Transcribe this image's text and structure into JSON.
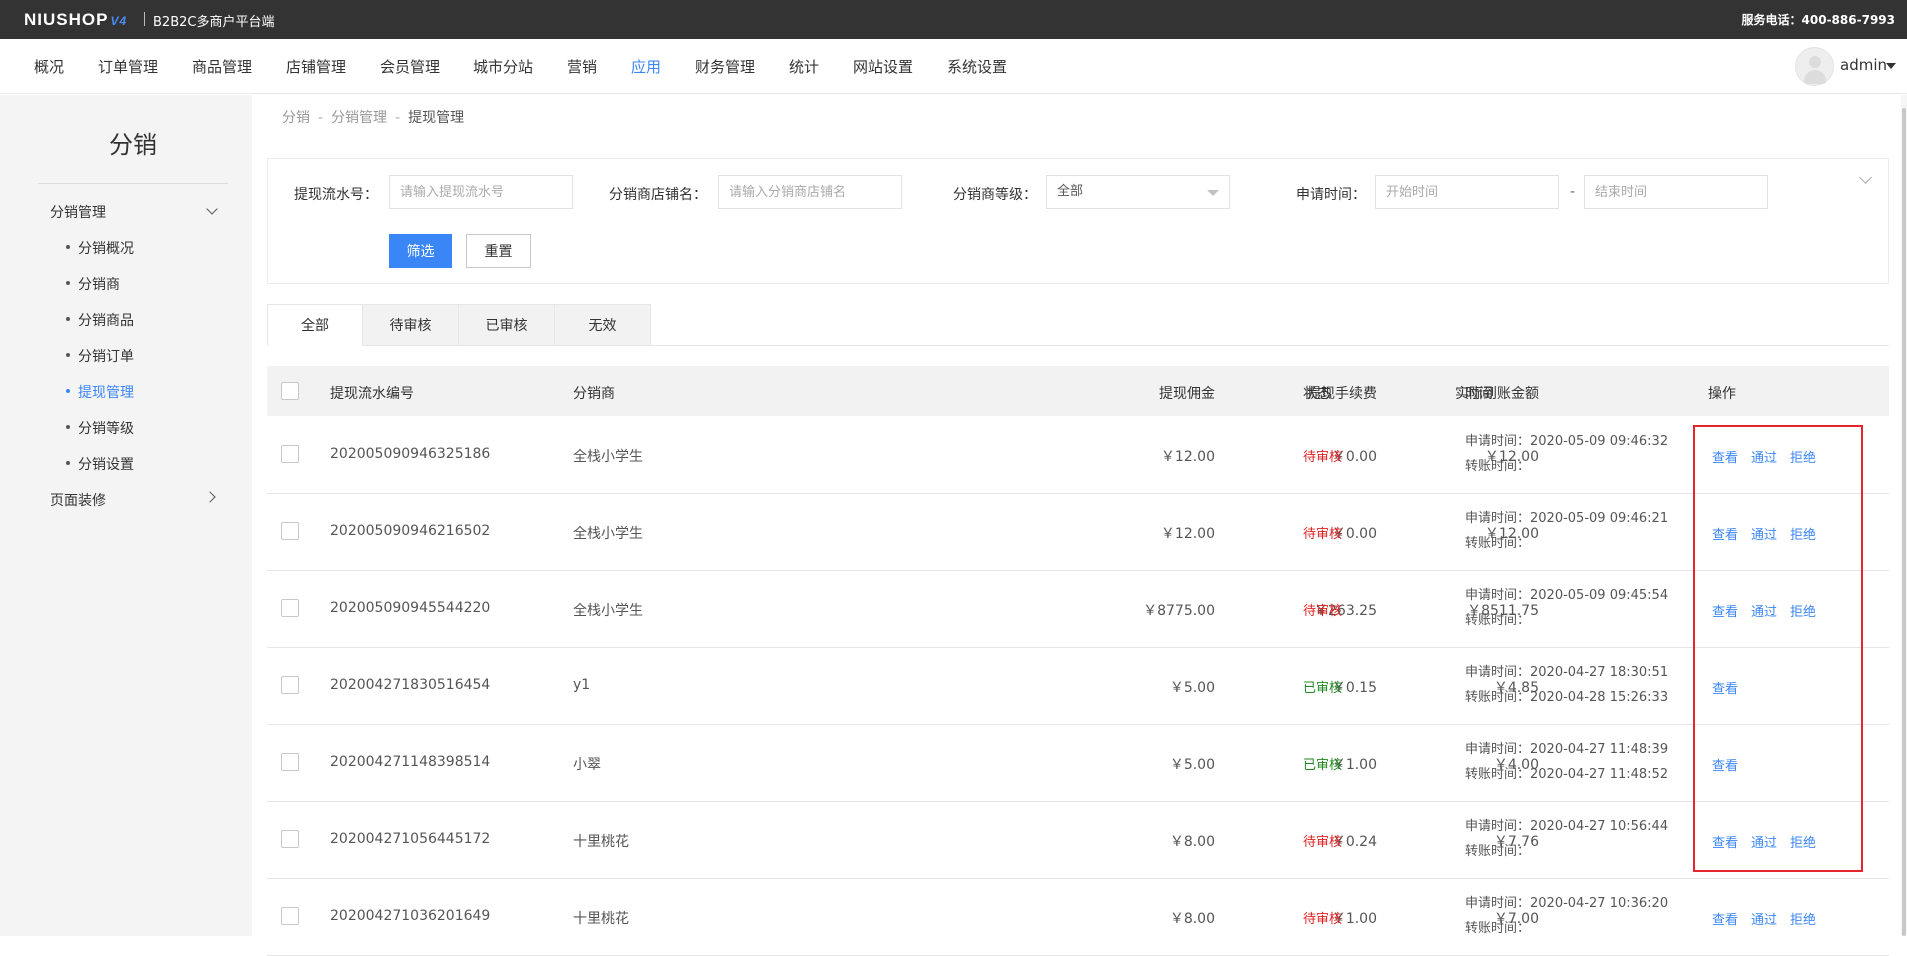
{
  "topbar": {
    "logo_text": "NIUSHOP",
    "logo_version": "V4",
    "platform": "B2B2C多商户平台端",
    "phone_label": "服务电话：400-886-7993"
  },
  "nav": {
    "items": [
      "概况",
      "订单管理",
      "商品管理",
      "店铺管理",
      "会员管理",
      "城市分站",
      "营销",
      "应用",
      "财务管理",
      "统计",
      "网站设置",
      "系统设置"
    ],
    "active": "应用",
    "user": "admin"
  },
  "sidebar": {
    "title": "分销",
    "group1": "分销管理",
    "items": [
      "分销概况",
      "分销商",
      "分销商品",
      "分销订单",
      "提现管理",
      "分销等级",
      "分销设置"
    ],
    "active": "提现管理",
    "group2": "页面装修"
  },
  "breadcrumb": {
    "items": [
      "分销",
      "分销管理",
      "提现管理"
    ],
    "sep": "-"
  },
  "filter": {
    "serial_label": "提现流水号：",
    "serial_placeholder": "请输入提现流水号",
    "shop_label": "分销商店铺名：",
    "shop_placeholder": "请输入分销商店铺名",
    "level_label": "分销商等级：",
    "level_value": "全部",
    "time_label": "申请时间：",
    "start_placeholder": "开始时间",
    "end_placeholder": "结束时间",
    "dash": "-",
    "filter_button": "筛选",
    "reset_button": "重置"
  },
  "tabs": [
    "全部",
    "待审核",
    "已审核",
    "无效"
  ],
  "active_tab": "全部",
  "table": {
    "headers": [
      "提现流水编号",
      "分销商",
      "提现佣金",
      "提现手续费",
      "实际到账金额",
      "状态",
      "时间",
      "操作"
    ],
    "apply_prefix": "申请时间：",
    "transfer_prefix": "转账时间：",
    "rows": [
      {
        "serial": "202005090946325186",
        "distributor": "全栈小学生",
        "commission": "￥12.00",
        "fee": "￥0.00",
        "actual": "￥12.00",
        "status": "待审核",
        "status_type": "pending",
        "apply_time": "2020-05-09 09:46:32",
        "transfer_time": "",
        "actions": [
          "查看",
          "通过",
          "拒绝"
        ]
      },
      {
        "serial": "202005090946216502",
        "distributor": "全栈小学生",
        "commission": "￥12.00",
        "fee": "￥0.00",
        "actual": "￥12.00",
        "status": "待审核",
        "status_type": "pending",
        "apply_time": "2020-05-09 09:46:21",
        "transfer_time": "",
        "actions": [
          "查看",
          "通过",
          "拒绝"
        ]
      },
      {
        "serial": "202005090945544220",
        "distributor": "全栈小学生",
        "commission": "￥8775.00",
        "fee": "￥263.25",
        "actual": "￥8511.75",
        "status": "待审核",
        "status_type": "pending",
        "apply_time": "2020-05-09 09:45:54",
        "transfer_time": "",
        "actions": [
          "查看",
          "通过",
          "拒绝"
        ]
      },
      {
        "serial": "202004271830516454",
        "distributor": "y1",
        "commission": "￥5.00",
        "fee": "￥0.15",
        "actual": "￥4.85",
        "status": "已审核",
        "status_type": "approved",
        "apply_time": "2020-04-27 18:30:51",
        "transfer_time": "2020-04-28 15:26:33",
        "actions": [
          "查看"
        ]
      },
      {
        "serial": "202004271148398514",
        "distributor": "小翠",
        "commission": "￥5.00",
        "fee": "￥1.00",
        "actual": "￥4.00",
        "status": "已审核",
        "status_type": "approved",
        "apply_time": "2020-04-27 11:48:39",
        "transfer_time": "2020-04-27 11:48:52",
        "actions": [
          "查看"
        ]
      },
      {
        "serial": "202004271056445172",
        "distributor": "十里桃花",
        "commission": "￥8.00",
        "fee": "￥0.24",
        "actual": "￥7.76",
        "status": "待审核",
        "status_type": "pending",
        "apply_time": "2020-04-27 10:56:44",
        "transfer_time": "",
        "actions": [
          "查看",
          "通过",
          "拒绝"
        ]
      },
      {
        "serial": "202004271036201649",
        "distributor": "十里桃花",
        "commission": "￥8.00",
        "fee": "￥1.00",
        "actual": "￥7.00",
        "status": "待审核",
        "status_type": "pending",
        "apply_time": "2020-04-27 10:36:20",
        "transfer_time": "",
        "actions": [
          "查看",
          "通过",
          "拒绝"
        ]
      }
    ]
  },
  "colors": {
    "accent": "#3b86f7",
    "pending": "#e02020",
    "approved": "#1f8a1f",
    "highlight": "#e8242c",
    "topbar": "#333333"
  }
}
